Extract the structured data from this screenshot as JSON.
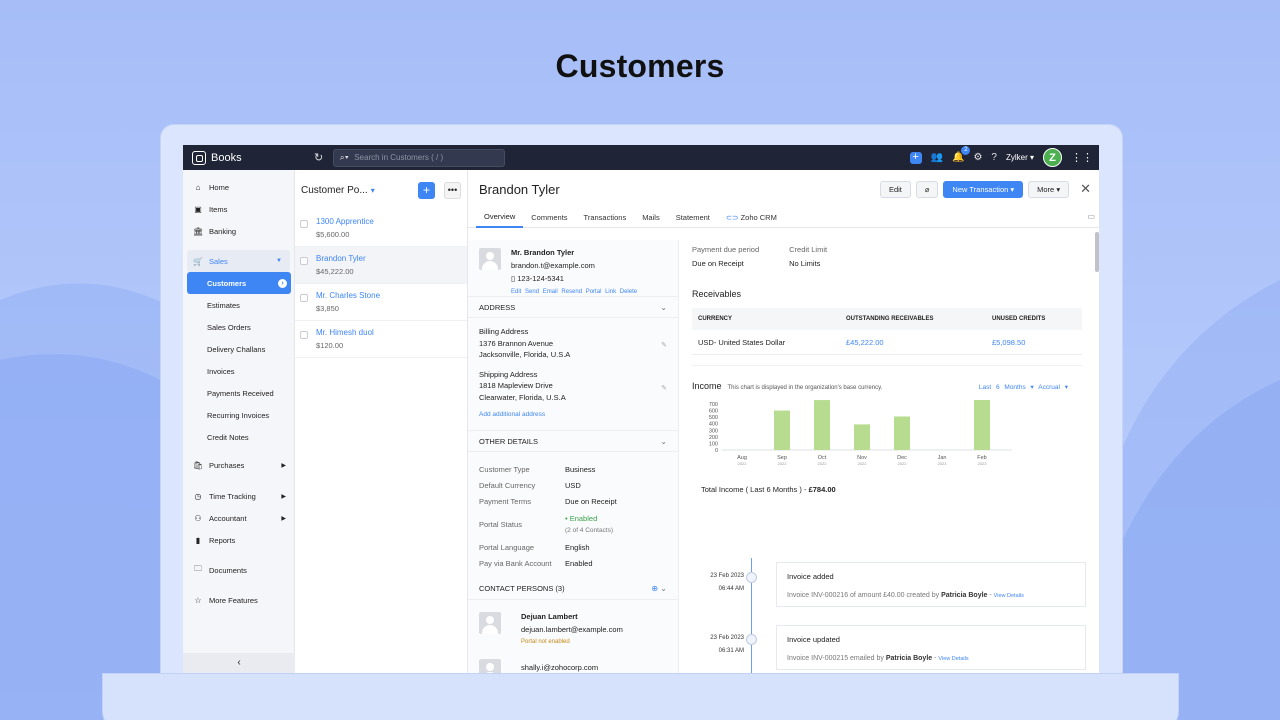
{
  "hero_title": "Customers",
  "topbar": {
    "app_name": "Books",
    "search_placeholder": "Search in Customers ( / )",
    "notif_count": "2",
    "org": "Zylker",
    "avatar_letter": "Z"
  },
  "sidebar": {
    "home": "Home",
    "items": "Items",
    "banking": "Banking",
    "sales": "Sales",
    "sales_items": [
      "Customers",
      "Estimates",
      "Sales Orders",
      "Delivery Challans",
      "Invoices",
      "Payments Received",
      "Recurring Invoices",
      "Credit Notes"
    ],
    "purchases": "Purchases",
    "time_tracking": "Time Tracking",
    "accountant": "Accountant",
    "reports": "Reports",
    "documents": "Documents",
    "more_features": "More Features"
  },
  "list": {
    "title": "Customer Po...",
    "rows": [
      {
        "name": "1300 Apprentice",
        "amount": "$5,600.00"
      },
      {
        "name": "Brandon Tyler",
        "amount": "$45,222.00"
      },
      {
        "name": "Mr. Charles Stone",
        "amount": "$3,850"
      },
      {
        "name": "Mr. Himesh duol",
        "amount": "$120.00"
      }
    ]
  },
  "detail": {
    "title": "Brandon Tyler",
    "edit": "Edit",
    "new_transaction": "New Transaction",
    "more": "More",
    "tabs": [
      "Overview",
      "Comments",
      "Transactions",
      "Mails",
      "Statement",
      "Zoho CRM"
    ],
    "contact": {
      "name": "Mr. Brandon Tyler",
      "email": "brandon.t@example.com",
      "phone": "123-124-5341",
      "links": [
        "Edit",
        "Send Email",
        "Resend Portal Link",
        "Delete"
      ]
    },
    "address_h": "ADDRESS",
    "billing": {
      "label": "Billing Address",
      "line1": "1376 Brannon Avenue",
      "line2": "Jacksonville, Florida, U.S.A"
    },
    "shipping": {
      "label": "Shipping Address",
      "line1": "1818 Mapleview Drive",
      "line2": "Clearwater, Florida, U.S.A"
    },
    "add_address": "Add additional address",
    "other_h": "OTHER DETAILS",
    "other": [
      {
        "k": "Customer Type",
        "v": "Business"
      },
      {
        "k": "Default Currency",
        "v": "USD"
      },
      {
        "k": "Payment Terms",
        "v": "Due on Receipt"
      }
    ],
    "portal_status_k": "Portal Status",
    "portal_status_v": "• Enabled",
    "portal_status_note": "(2 of 4 Contacts)",
    "other2": [
      {
        "k": "Portal Language",
        "v": "English"
      },
      {
        "k": "Pay via Bank Account",
        "v": "Enabled"
      }
    ],
    "contacts_h": "CONTACT PERSONS (3)",
    "person1": {
      "name": "Dejuan Lambert",
      "email": "dejuan.lambert@example.com",
      "status": "Portal not enabled"
    },
    "person2_email": "shally.i@zohocorp.com",
    "payment_due_label": "Payment due period",
    "payment_due_value": "Due on Receipt",
    "credit_limit_label": "Credit Limit",
    "credit_limit_value": "No Limits",
    "receivables_h": "Receivables",
    "recv_cols": [
      "CURRENCY",
      "OUTSTANDING RECEIVABLES",
      "UNUSED CREDITS"
    ],
    "recv_row": [
      "USD- United States Dollar",
      "£45,222.00",
      "£5,098.50"
    ],
    "income_title": "Income",
    "income_note": "This chart is displayed in the organization's base currency.",
    "income_filter1": "Last 6 Months ▾",
    "income_filter2": "Accrual ▾",
    "total_label": "Total Income ( Last 6 Months ) -",
    "total_value": "£784.00",
    "timeline": [
      {
        "date": "23 Feb 2023",
        "time": "06:44 AM",
        "title": "Invoice added",
        "body_pre": "Invoice INV-000216 of amount £40.00 created by",
        "by": "Patricia Boyle",
        "link": "View Details"
      },
      {
        "date": "23 Feb 2023",
        "time": "06:31 AM",
        "title": "Invoice updated",
        "body_pre": "Invoice INV-000215 emailed by",
        "by": "Patricia Boyle",
        "link": "View Details"
      }
    ]
  },
  "chart_data": {
    "type": "bar",
    "title": "Income",
    "categories": [
      "Aug 2022",
      "Sep 2022",
      "Oct 2022",
      "Nov 2022",
      "Dec 2022",
      "Jan 2023",
      "Feb 2023"
    ],
    "x_tick_labels": [
      [
        "Aug",
        "2022"
      ],
      [
        "Sep",
        "2022"
      ],
      [
        "Oct",
        "2022"
      ],
      [
        "Nov",
        "2022"
      ],
      [
        "Dec",
        "2022"
      ],
      [
        "Jan",
        "2023"
      ],
      [
        "Feb",
        "2023"
      ]
    ],
    "values": [
      0,
      600,
      760,
      390,
      510,
      0,
      770
    ],
    "ylim": [
      0,
      700
    ],
    "yticks": [
      0,
      100,
      200,
      300,
      400,
      500,
      600,
      700
    ],
    "bar_color": "#b7dc8f",
    "grid": false
  }
}
